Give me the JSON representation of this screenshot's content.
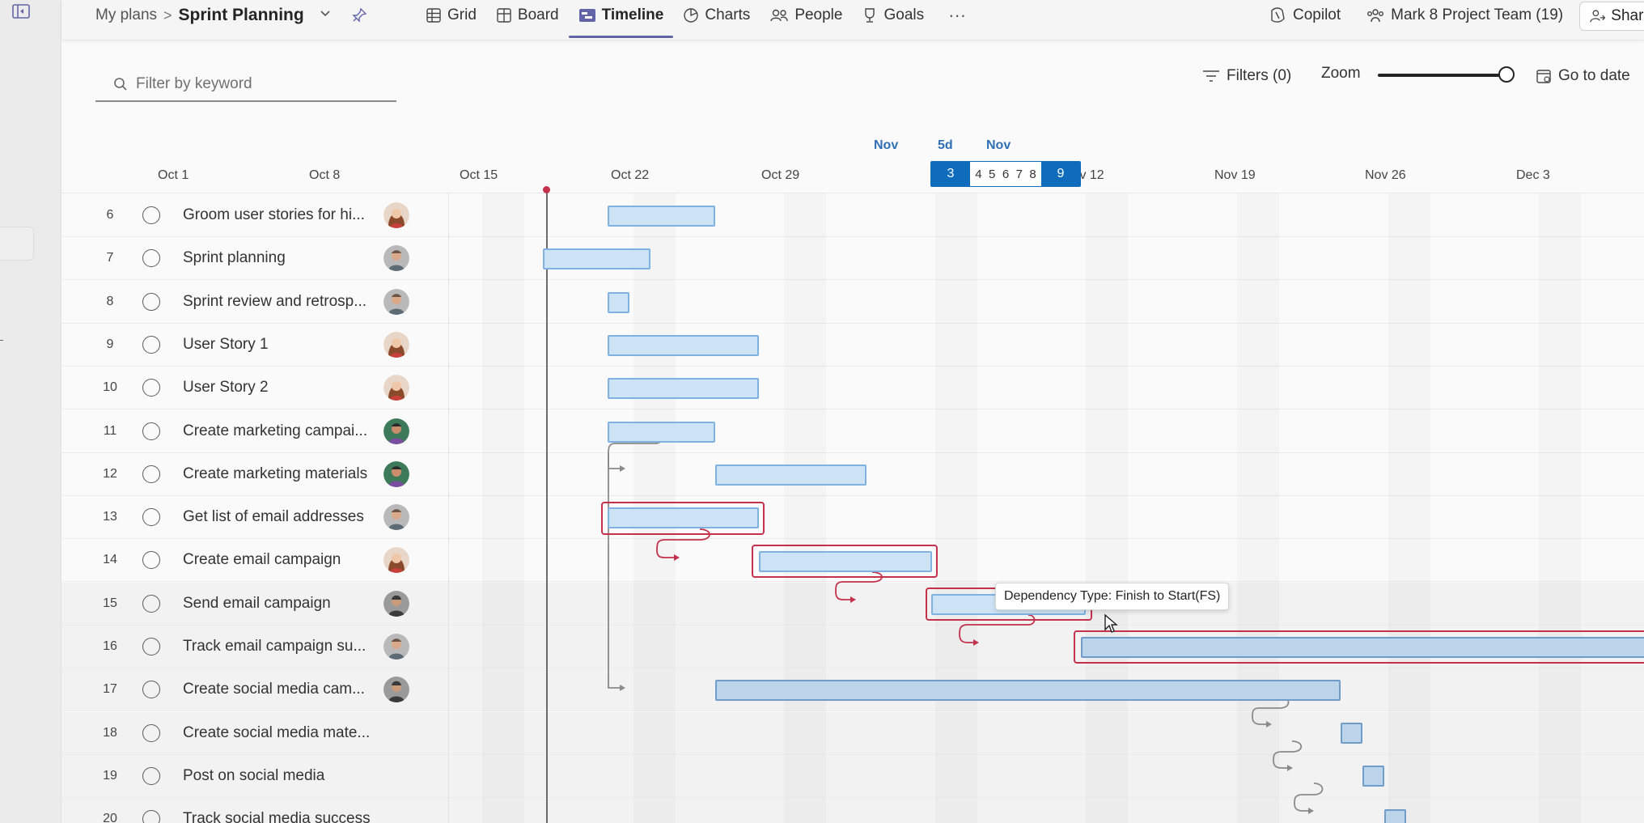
{
  "app": {
    "accent": "#6264a7",
    "critical_color": "#c4314b",
    "bar_color": "#cde3f5"
  },
  "breadcrumb": {
    "parent": "My plans",
    "separator": ">",
    "title": "Sprint Planning"
  },
  "tabs": [
    {
      "label": "Grid",
      "icon": "grid-icon",
      "active": false
    },
    {
      "label": "Board",
      "icon": "board-icon",
      "active": false
    },
    {
      "label": "Timeline",
      "icon": "timeline-icon",
      "active": true
    },
    {
      "label": "Charts",
      "icon": "charts-icon",
      "active": false
    },
    {
      "label": "People",
      "icon": "people-icon",
      "active": false
    },
    {
      "label": "Goals",
      "icon": "goals-icon",
      "active": false
    }
  ],
  "tab_more": "···",
  "toolbar_right": {
    "copilot": "Copilot",
    "team": "Mark 8 Project Team (19)",
    "share": "Share"
  },
  "search": {
    "placeholder": "Filter by keyword"
  },
  "filters": {
    "label": "Filters (0)"
  },
  "zoom": {
    "label": "Zoom",
    "level": 1.0
  },
  "goto": {
    "label": "Go to date"
  },
  "timeline": {
    "dates": [
      "Oct 1",
      "Oct 8",
      "Oct 15",
      "Oct 22",
      "Oct 29",
      "Nov 12",
      "Nov 19",
      "Nov 26",
      "Dec 3"
    ],
    "selection": {
      "month_start": "Nov",
      "duration": "5d",
      "month_end": "Nov",
      "start_day": "3",
      "mid_days": [
        "4",
        "5",
        "6",
        "7",
        "8"
      ],
      "end_day": "9"
    }
  },
  "tasks": [
    {
      "num": "6",
      "name": "Groom user stories for hi...",
      "avatar": "woman"
    },
    {
      "num": "7",
      "name": "Sprint planning",
      "avatar": "man-grey"
    },
    {
      "num": "8",
      "name": "Sprint review and retrosp...",
      "avatar": "man-grey"
    },
    {
      "num": "9",
      "name": "User Story 1",
      "avatar": "woman"
    },
    {
      "num": "10",
      "name": "User Story 2",
      "avatar": "woman"
    },
    {
      "num": "11",
      "name": "Create marketing campai...",
      "avatar": "man-green"
    },
    {
      "num": "12",
      "name": "Create marketing materials",
      "avatar": "man-green"
    },
    {
      "num": "13",
      "name": "Get list of email addresses",
      "avatar": "man-grey"
    },
    {
      "num": "14",
      "name": "Create email campaign",
      "avatar": "woman"
    },
    {
      "num": "15",
      "name": "Send email campaign",
      "avatar": "man-dark"
    },
    {
      "num": "16",
      "name": "Track email campaign su...",
      "avatar": "man-grey"
    },
    {
      "num": "17",
      "name": "Create social media cam...",
      "avatar": "man-dark"
    },
    {
      "num": "18",
      "name": "Create social media mate...",
      "avatar": ""
    },
    {
      "num": "19",
      "name": "Post on social media",
      "avatar": ""
    },
    {
      "num": "20",
      "name": "Track social media success",
      "avatar": ""
    }
  ],
  "tooltip": {
    "text": "Dependency Type: Finish to Start(FS)"
  }
}
